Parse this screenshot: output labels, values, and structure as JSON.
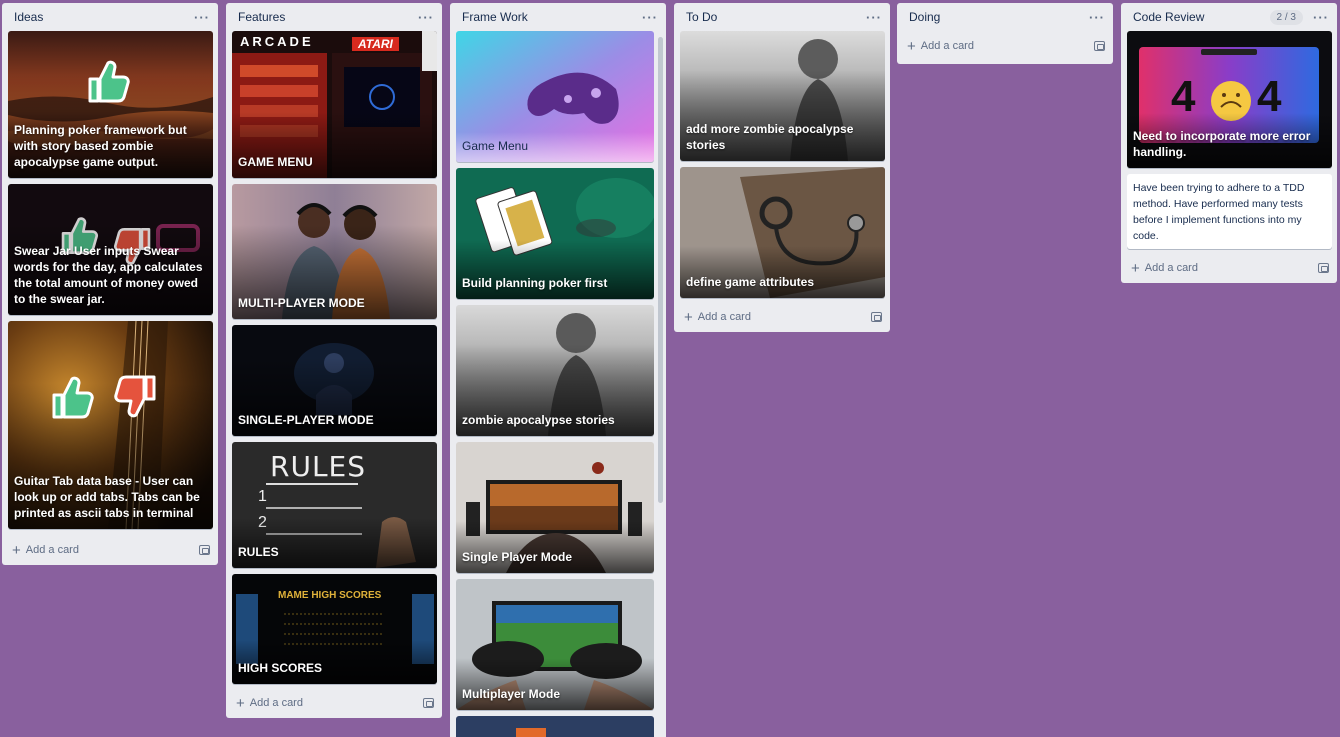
{
  "lists": {
    "ideas": {
      "title": "Ideas",
      "cards": [
        "Planning poker framework but with story based zombie apocalypse game output.",
        "Swear Jar User inputs Swear words for the day, app calculates the total amount of money owed to the swear jar.",
        "Guitar Tab data base - User can look up or add tabs. Tabs can be printed as ascii tabs in terminal"
      ],
      "add_card": "Add a card"
    },
    "features": {
      "title": "Features",
      "cards": [
        "GAME MENU",
        "MULTI-PLAYER MODE",
        "SINGLE-PLAYER MODE",
        "RULES",
        "HIGH SCORES"
      ],
      "add_card": "Add a card"
    },
    "framework": {
      "title": "Frame Work",
      "cards": [
        "Game Menu",
        "Build planning poker first",
        "zombie apocalypse stories",
        "Single Player Mode",
        "Multiplayer Mode"
      ]
    },
    "todo": {
      "title": "To Do",
      "cards": [
        "add more zombie apocalypse stories",
        "define game attributes"
      ],
      "add_card": "Add a card"
    },
    "doing": {
      "title": "Doing",
      "add_card": "Add a card"
    },
    "code_review": {
      "title": "Code Review",
      "count": "2 / 3",
      "cards": [
        "Need to incorporate more error handling.",
        "Have been trying to adhere to a TDD method. Have performed many tests before I implement functions into my code."
      ],
      "add_card": "Add a card"
    }
  },
  "image_text": {
    "arcade": "ARCADE",
    "atari": "ATARI",
    "rules": "RULES",
    "rules_1": "1",
    "rules_2": "2",
    "mame": "MAME HIGH SCORES",
    "error_code_a": "4",
    "error_code_b": "4"
  },
  "menu_glyph": "···",
  "plus_glyph": "+",
  "colors": {
    "board_background": "#89609e",
    "list_background": "#ebecf0",
    "thumb_up": "#4cc38a",
    "thumb_down": "#e5533d"
  },
  "icons": [
    "thumbs-up-icon",
    "thumbs-down-icon",
    "plus-icon",
    "template-icon",
    "more-icon"
  ]
}
